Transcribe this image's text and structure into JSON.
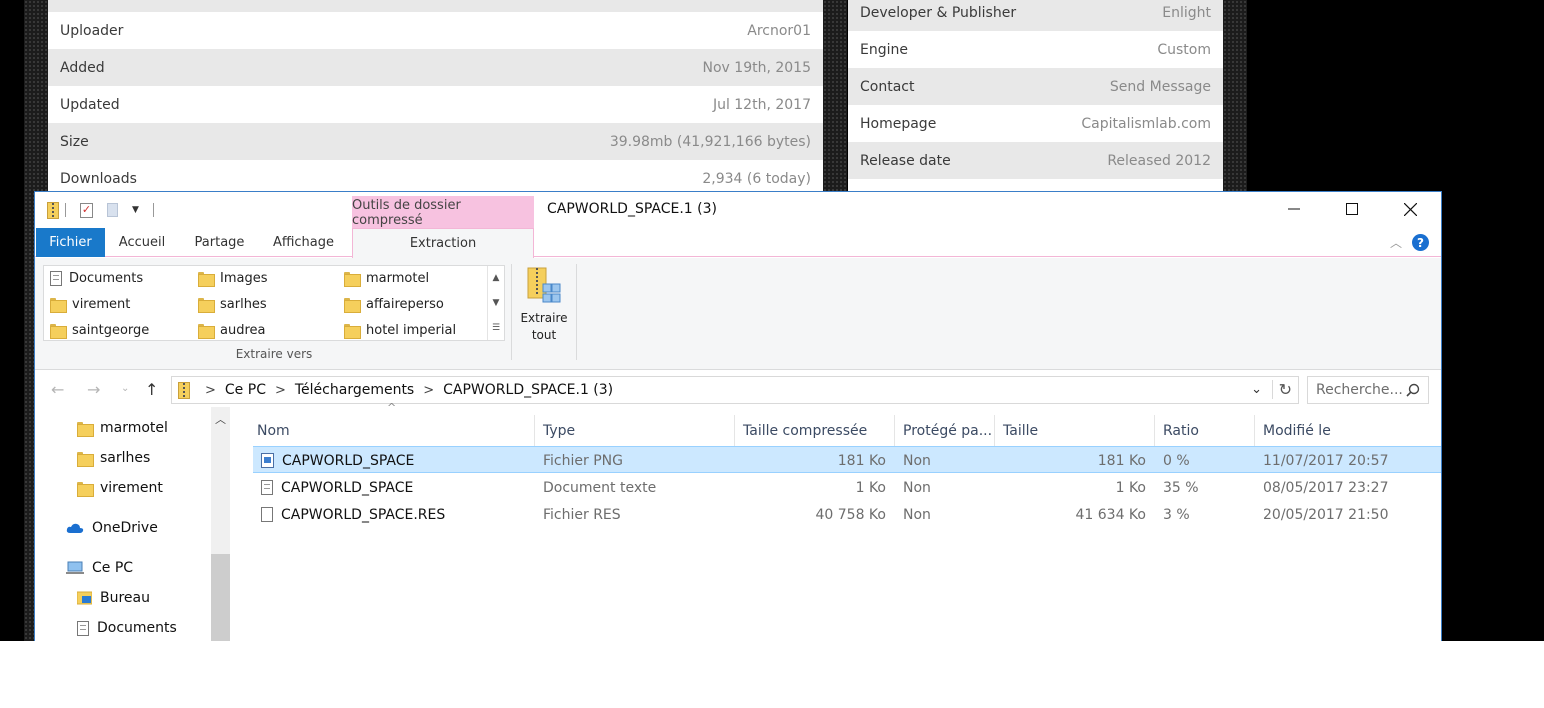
{
  "website": {
    "left_rows": [
      {
        "key": "Uploader",
        "value": "Arcnor01"
      },
      {
        "key": "Added",
        "value": "Nov 19th, 2015"
      },
      {
        "key": "Updated",
        "value": "Jul 12th, 2017"
      },
      {
        "key": "Size",
        "value": "39.98mb (41,921,166 bytes)"
      },
      {
        "key": "Downloads",
        "value": "2,934 (6 today)"
      }
    ],
    "right_rows": [
      {
        "key": "Developer & Publisher",
        "value": "Enlight"
      },
      {
        "key": "Engine",
        "value": "Custom"
      },
      {
        "key": "Contact",
        "value": "Send Message"
      },
      {
        "key": "Homepage",
        "value": "Capitalismlab.com"
      },
      {
        "key": "Release date",
        "value": "Released 2012"
      }
    ]
  },
  "explorer": {
    "title": "CAPWORLD_SPACE.1 (3)",
    "context_tab_label": "Outils de dossier compressé",
    "tabs": {
      "file": "Fichier",
      "home": "Accueil",
      "share": "Partage",
      "view": "Affichage",
      "extract": "Extraction"
    },
    "ribbon": {
      "destinations": [
        "Documents",
        "Images",
        "marmotel",
        "virement",
        "sarlhes",
        "affaireperso",
        "saintgeorge",
        "audrea",
        "hotel imperial"
      ],
      "group_label": "Extraire vers",
      "extract_all_line1": "Extraire",
      "extract_all_line2": "tout"
    },
    "address": {
      "crumbs": [
        "Ce PC",
        "Téléchargements",
        "CAPWORLD_SPACE.1 (3)"
      ],
      "search_placeholder": "Recherche..."
    },
    "nav_pane": {
      "items": [
        {
          "label": "marmotel"
        },
        {
          "label": "sarlhes"
        },
        {
          "label": "virement"
        },
        {
          "label": "OneDrive"
        },
        {
          "label": "Ce PC"
        },
        {
          "label": "Bureau"
        },
        {
          "label": "Documents"
        }
      ]
    },
    "columns": [
      "Nom",
      "Type",
      "Taille compressée",
      "Protégé pa...",
      "Taille",
      "Ratio",
      "Modifié le"
    ],
    "files": [
      {
        "name": "CAPWORLD_SPACE",
        "type": "Fichier PNG",
        "compressed": "181 Ko",
        "protected": "Non",
        "size": "181 Ko",
        "ratio": "0 %",
        "modified": "11/07/2017 20:57",
        "icon": "image-file-icon"
      },
      {
        "name": "CAPWORLD_SPACE",
        "type": "Document texte",
        "compressed": "1 Ko",
        "protected": "Non",
        "size": "1 Ko",
        "ratio": "35 %",
        "modified": "08/05/2017 23:27",
        "icon": "text-file-icon"
      },
      {
        "name": "CAPWORLD_SPACE.RES",
        "type": "Fichier RES",
        "compressed": "40 758 Ko",
        "protected": "Non",
        "size": "41 634 Ko",
        "ratio": "3 %",
        "modified": "20/05/2017 21:50",
        "icon": "file-icon"
      }
    ]
  }
}
